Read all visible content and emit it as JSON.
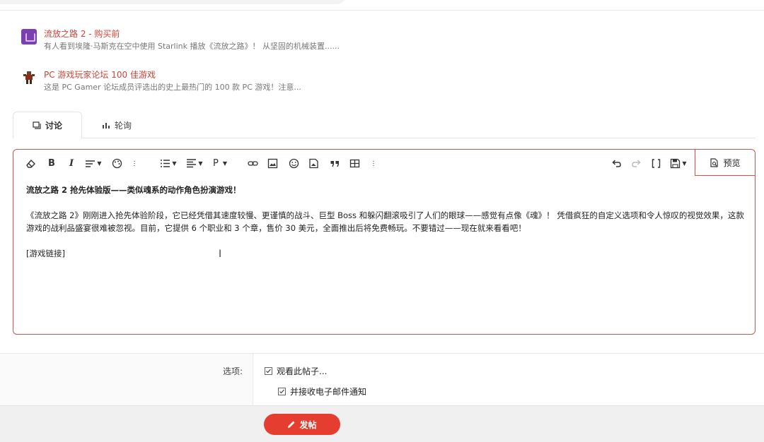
{
  "related": [
    {
      "title": "流放之路 2 - 购买前",
      "desc": "有人看到埃隆·马斯克在空中使用 Starlink 播放《流放之路》！ 从坚固的机械装置......",
      "icon": "game-thumbnail-icon"
    },
    {
      "title": "PC 游戏玩家论坛 100 佳游戏",
      "desc": "这是 PC Gamer 论坛成员评选出的史上最热门的 100 款 PC 游戏！注意...",
      "icon": "character-thumbnail-icon"
    }
  ],
  "tabs": {
    "discussion": "讨论",
    "poll": "轮询"
  },
  "toolbar": {
    "bold": "B",
    "italic": "I",
    "paragraph": "P",
    "preview": "预览"
  },
  "editor": {
    "heading": "流放之路 2 抢先体验版——类似魂系的动作角色扮演游戏！",
    "body": "《流放之路 2》刚刚进入抢先体验阶段，它已经凭借其速度较慢、更谨慎的战斗、巨型 Boss 和躲闪翻滚吸引了人们的眼球——感觉有点像《魂》！ 凭借疯狂的自定义选项和令人惊叹的视觉效果，这款游戏的战利品盛宴很难被忽视。目前，它提供 6 个职业和 3 个章，售价 30 美元，全面推出后将免费畅玩。不要错过——现在就来看看吧！",
    "link": "[游戏链接]"
  },
  "options": {
    "label": "选项:",
    "watch": "观看此帖子...",
    "email": "并接收电子邮件通知"
  },
  "submit": "发帖",
  "colors": {
    "accent": "#e53d2f",
    "link": "#c8453a",
    "border": "#c9554a"
  }
}
